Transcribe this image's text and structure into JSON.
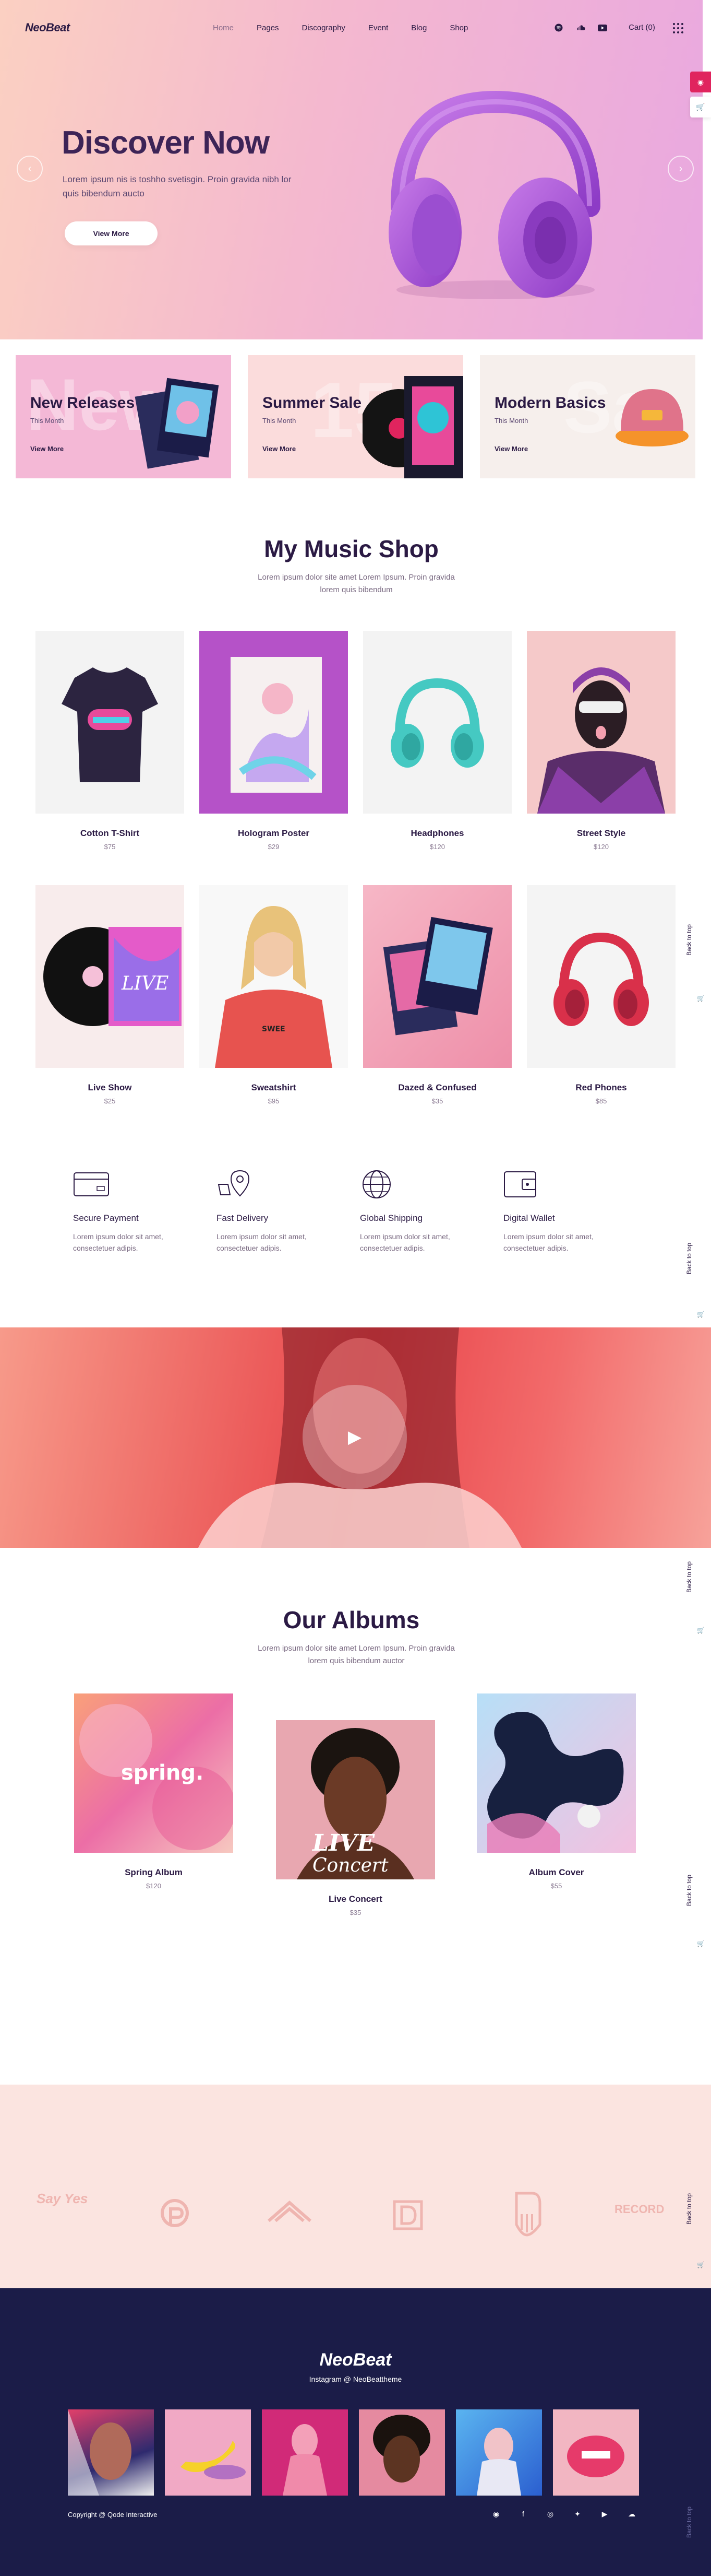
{
  "header": {
    "logo": "NeoBeat",
    "menu": [
      "Home",
      "Pages",
      "Discography",
      "Event",
      "Blog",
      "Shop"
    ],
    "cart_label": "Cart (0)",
    "social_icons": [
      "spotify-icon",
      "soundcloud-icon",
      "youtube-icon"
    ]
  },
  "hero": {
    "title": "Discover Now",
    "text": "Lorem ipsum nis is toshho svetisgin. Proin gravida nibh lor quis bibendum aucto",
    "button": "View More",
    "prev_icon": "arrow-left-circle-icon",
    "next_icon": "arrow-right-circle-icon"
  },
  "promos": [
    {
      "title": "New Releases",
      "sub": "This Month",
      "link": "View More",
      "bg_text": "New",
      "bg_color": "#f4b8d6"
    },
    {
      "title": "Summer Sale",
      "sub": "This Month",
      "link": "View More",
      "bg_text": "15",
      "bg_color": "#fbdcdc"
    },
    {
      "title": "Modern Basics",
      "sub": "This Month",
      "link": "View More",
      "bg_text": "Sa",
      "bg_color": "#f6efec"
    }
  ],
  "shop": {
    "title": "My Music Shop",
    "subtitle": "Lorem ipsum dolor site amet Lorem Ipsum. Proin gravida lorem quis bibendum",
    "products": [
      {
        "name": "Cotton T-Shirt",
        "price": "$75"
      },
      {
        "name": "Hologram Poster",
        "price": "$29"
      },
      {
        "name": "Headphones",
        "price": "$120"
      },
      {
        "name": "Street Style",
        "price": "$120"
      },
      {
        "name": "Live Show",
        "price": "$25"
      },
      {
        "name": "Sweatshirt",
        "price": "$95"
      },
      {
        "name": "Dazed & Confused",
        "price": "$35"
      },
      {
        "name": "Red Phones",
        "price": "$85"
      }
    ]
  },
  "features": [
    {
      "title": "Secure Payment",
      "text": "Lorem ipsum dolor sit amet, consectetuer adipis.",
      "icon": "credit-card-icon"
    },
    {
      "title": "Fast Delivery",
      "text": "Lorem ipsum dolor sit amet, consectetuer adipis.",
      "icon": "location-pin-icon"
    },
    {
      "title": "Global Shipping",
      "text": "Lorem ipsum dolor sit amet, consectetuer adipis.",
      "icon": "globe-icon"
    },
    {
      "title": "Digital Wallet",
      "text": "Lorem ipsum dolor sit amet, consectetuer adipis.",
      "icon": "wallet-icon"
    }
  ],
  "albums": {
    "title": "Our Albums",
    "subtitle": "Lorem ipsum dolor site amet Lorem Ipsum. Proin gravida lorem quis bibendum auctor",
    "items": [
      {
        "name": "Spring Album",
        "price": "$120",
        "cover_text": "spring."
      },
      {
        "name": "Live Concert",
        "price": "$35",
        "cover_text": "LIVE Concert"
      },
      {
        "name": "Album Cover",
        "price": "$55",
        "cover_text": ""
      }
    ]
  },
  "clients": [
    "Say Yes",
    "P",
    "Mountain",
    "D",
    "Piano",
    "RECORD"
  ],
  "footer": {
    "logo": "NeoBeat",
    "instagram": "Instagram @ NeoBeattheme",
    "copyright": "Copyright @ Qode Interactive",
    "social": [
      "spotify-icon",
      "facebook-icon",
      "instagram-icon",
      "twitter-icon",
      "youtube-icon",
      "soundcloud-icon"
    ]
  },
  "side": {
    "back_to_top": "Back to top"
  },
  "colors": {
    "primary": "#2b1a44",
    "accent": "#e0245e",
    "footer_bg": "#1b1c48",
    "clients_bg": "#fbe4e0"
  }
}
